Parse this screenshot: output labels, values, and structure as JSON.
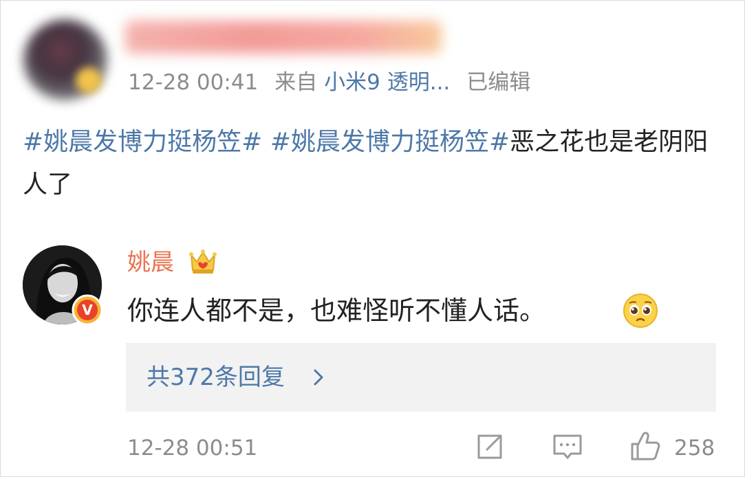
{
  "comment": {
    "timestamp": "12-28 00:41",
    "source_prefix": "来自",
    "source_device": "小米9 透明...",
    "edited_label": "已编辑",
    "tag_1": "#姚晨发博力挺杨笠#",
    "tag_2": "#姚晨发博力挺杨笠#",
    "text_after_tags": "恶之花也是老阴阳人了"
  },
  "reply": {
    "author": "姚晨",
    "text": "你连人都不是，也难怪听不懂人话。",
    "vip_badge_letter": "V"
  },
  "replies_link": {
    "label": "共372条回复"
  },
  "footer": {
    "timestamp": "12-28 00:51",
    "like_count": "258"
  },
  "icons": {
    "vip": "verified-v-icon",
    "crown": "crown-icon",
    "emoji": "pleading-face-icon",
    "chevron": "chevron-right-icon",
    "share": "share-icon",
    "comment": "comment-icon",
    "like": "thumbs-up-icon"
  },
  "colors": {
    "link_blue": "#4d78a8",
    "author_orange": "#eb7350",
    "meta_gray": "#8c8c8c",
    "reply_box_bg": "#f2f2f2"
  }
}
